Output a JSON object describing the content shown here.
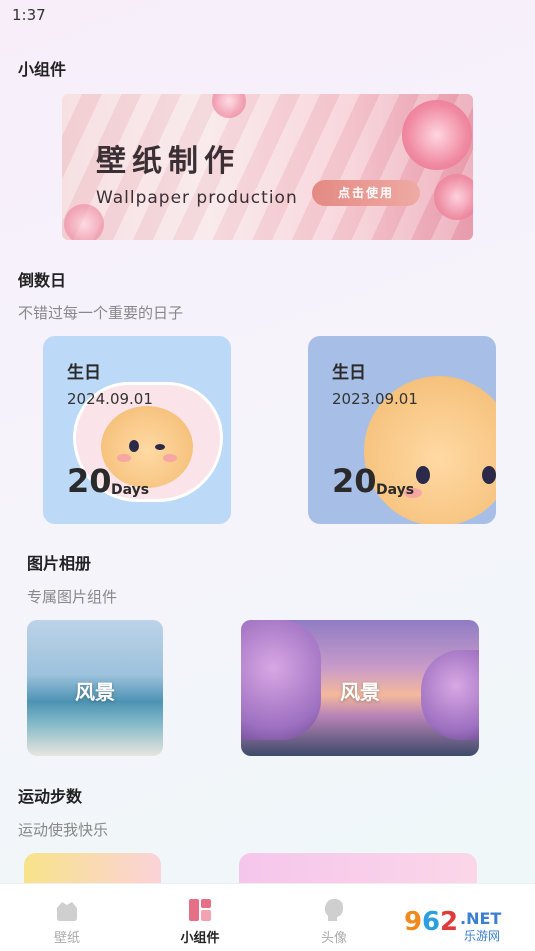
{
  "status": {
    "time": "1:37"
  },
  "widgets": {
    "title": "小组件"
  },
  "banner": {
    "title_cn": "壁纸制作",
    "title_en": "Wallpaper production",
    "cta": "点击使用"
  },
  "countdown": {
    "title": "倒数日",
    "subtitle": "不错过每一个重要的日子",
    "cards": [
      {
        "label": "生日",
        "date": "2024.09.01",
        "days": "20",
        "unit": "Days"
      },
      {
        "label": "生日",
        "date": "2023.09.01",
        "days": "20",
        "unit": "Days"
      }
    ]
  },
  "album": {
    "title": "图片相册",
    "subtitle": "专属图片组件",
    "items": [
      {
        "label": "风景"
      },
      {
        "label": "风景"
      }
    ]
  },
  "steps": {
    "title": "运动步数",
    "subtitle": "运动使我快乐"
  },
  "tabbar": {
    "tabs": [
      {
        "label": "壁纸",
        "icon": "wallpaper-icon"
      },
      {
        "label": "小组件",
        "icon": "widgets-icon"
      },
      {
        "label": "头像",
        "icon": "avatar-icon"
      }
    ],
    "active": "小组件"
  },
  "watermark": {
    "brand": "962",
    "suffix": ".NET",
    "sub": "乐游网"
  },
  "colors": {
    "accent": "#e46f87",
    "countdown_card1_bg": "#bcd9f8",
    "countdown_card2_bg": "#a7bfe6"
  }
}
